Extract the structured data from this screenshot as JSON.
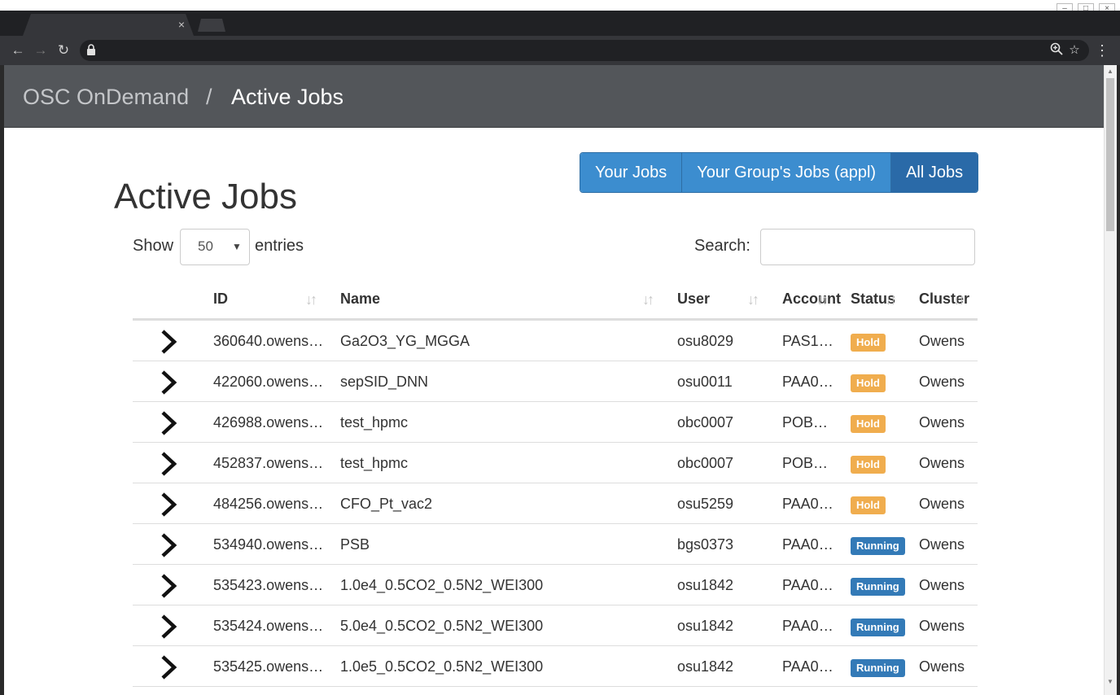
{
  "browser": {
    "tab_close": "×",
    "win_controls": [
      "–",
      "□",
      "×"
    ]
  },
  "navbar": {
    "brand": "OSC OnDemand",
    "separator": "/",
    "current": "Active Jobs"
  },
  "filters": {
    "your_jobs": "Your Jobs",
    "group_jobs": "Your Group's Jobs (appl)",
    "all_jobs": "All Jobs",
    "active": "All Jobs"
  },
  "page": {
    "heading": "Active Jobs"
  },
  "length": {
    "show": "Show",
    "value": "50",
    "entries": "entries"
  },
  "search": {
    "label": "Search:",
    "value": ""
  },
  "table": {
    "headers": {
      "id": "ID",
      "name": "Name",
      "user": "User",
      "account": "Account",
      "status": "Status",
      "cluster": "Cluster"
    },
    "rows": [
      {
        "id": "360640.owens…",
        "name": "Ga2O3_YG_MGGA",
        "user": "osu8029",
        "account": "PAS1…",
        "status": "Hold",
        "cluster": "Owens"
      },
      {
        "id": "422060.owens…",
        "name": "sepSID_DNN",
        "user": "osu0011",
        "account": "PAA0…",
        "status": "Hold",
        "cluster": "Owens"
      },
      {
        "id": "426988.owens…",
        "name": "test_hpmc",
        "user": "obc0007",
        "account": "POB…",
        "status": "Hold",
        "cluster": "Owens"
      },
      {
        "id": "452837.owens…",
        "name": "test_hpmc",
        "user": "obc0007",
        "account": "POB…",
        "status": "Hold",
        "cluster": "Owens"
      },
      {
        "id": "484256.owens…",
        "name": "CFO_Pt_vac2",
        "user": "osu5259",
        "account": "PAA0…",
        "status": "Hold",
        "cluster": "Owens"
      },
      {
        "id": "534940.owens…",
        "name": "PSB",
        "user": "bgs0373",
        "account": "PAA0…",
        "status": "Running",
        "cluster": "Owens"
      },
      {
        "id": "535423.owens…",
        "name": "1.0e4_0.5CO2_0.5N2_WEI300",
        "user": "osu1842",
        "account": "PAA0…",
        "status": "Running",
        "cluster": "Owens"
      },
      {
        "id": "535424.owens…",
        "name": "5.0e4_0.5CO2_0.5N2_WEI300",
        "user": "osu1842",
        "account": "PAA0…",
        "status": "Running",
        "cluster": "Owens"
      },
      {
        "id": "535425.owens…",
        "name": "1.0e5_0.5CO2_0.5N2_WEI300",
        "user": "osu1842",
        "account": "PAA0…",
        "status": "Running",
        "cluster": "Owens"
      }
    ]
  },
  "colors": {
    "navbar": "#53565a",
    "button": "#3c8dcf",
    "button_active": "#2a6aa8",
    "hold": "#f0ad4e",
    "running": "#337ab7"
  }
}
